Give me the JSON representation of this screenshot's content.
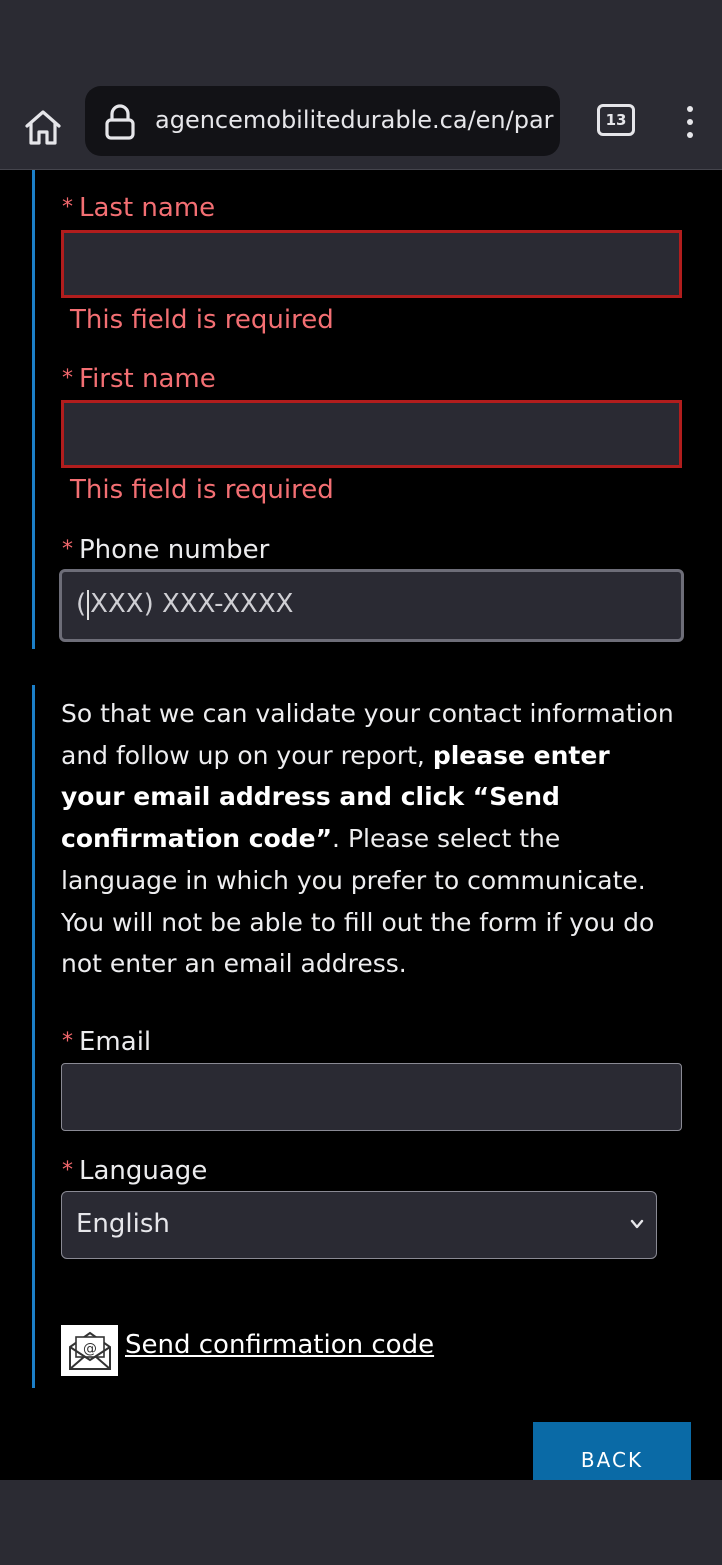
{
  "browser": {
    "url": "agencemobilitedurable.ca/en/parki",
    "tab_count": "13"
  },
  "form": {
    "required_marker": "*",
    "last_name": {
      "label": "Last name",
      "value": "",
      "error": "This field is required"
    },
    "first_name": {
      "label": "First name",
      "value": "",
      "error": "This field is required"
    },
    "phone": {
      "label": "Phone number",
      "placeholder_start": "(",
      "placeholder_rest": "XXX) XXX-XXXX"
    },
    "info": {
      "line1": "So that we can validate your contact information and follow up on your report, ",
      "bold": "please enter your email address and click “Send confirmation code”",
      "line2": ". Please select the language in which you prefer to communicate. You will not be able to fill out the form if you do not enter an email address."
    },
    "email": {
      "label": "Email",
      "value": ""
    },
    "language": {
      "label": "Language",
      "selected": "English"
    },
    "send_code_label": "Send confirmation code",
    "back_label": "BACK"
  },
  "colors": {
    "error": "#f36f73",
    "invalid_border": "#b11d1d",
    "accent": "#1c7fc8",
    "button": "#0a6aa6"
  }
}
